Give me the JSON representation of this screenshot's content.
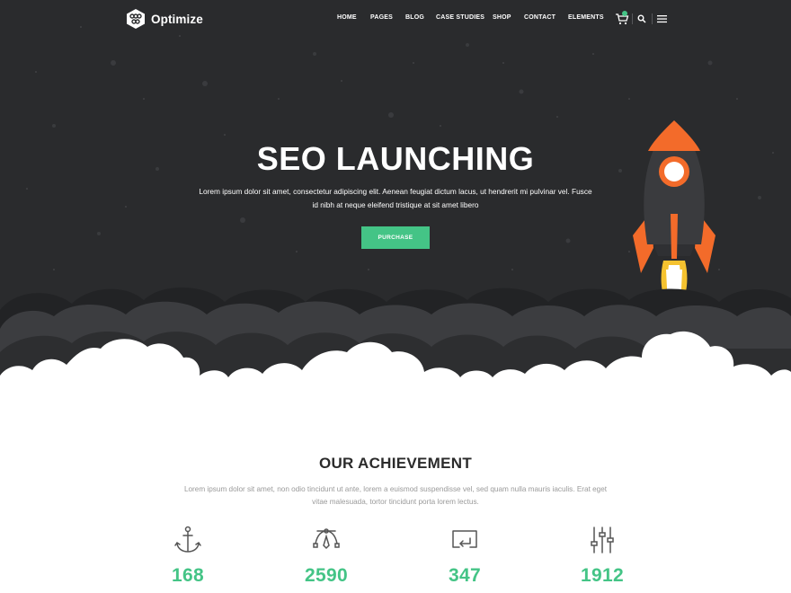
{
  "brand": {
    "name": "Optimize"
  },
  "nav": {
    "items": [
      "HOME",
      "PAGES",
      "BLOG",
      "CASE STUDIES",
      "SHOP",
      "CONTACT",
      "ELEMENTS"
    ],
    "icons": [
      "cart-icon",
      "search-icon",
      "menu-icon"
    ]
  },
  "hero": {
    "title": "SEO LAUNCHING",
    "text": "Lorem ipsum dolor sit amet, consectetur adipiscing elit. Aenean feugiat dictum lacus, ut hendrerit mi pulvinar vel. Fusce id nibh at neque eleifend tristique at sit amet libero",
    "button": "PURCHASE"
  },
  "achievement": {
    "title": "OUR ACHIEVEMENT",
    "text": "Lorem ipsum dolor sit amet, non odio tincidunt ut ante, lorem a euismod suspendisse vel, sed quam nulla mauris iaculis. Erat eget vitae malesuada, tortor tincidunt porta lorem lectus.",
    "stats": [
      {
        "icon": "anchor-icon",
        "value": "168"
      },
      {
        "icon": "bezier-pen-icon",
        "value": "2590"
      },
      {
        "icon": "monitor-return-icon",
        "value": "347"
      },
      {
        "icon": "equalizer-sliders-icon",
        "value": "1912"
      }
    ]
  },
  "colors": {
    "accent": "#44c486",
    "hero_bg": "#2a2b2d",
    "rocket_orange": "#f36b2a",
    "flame_yellow": "#f5c22f"
  }
}
